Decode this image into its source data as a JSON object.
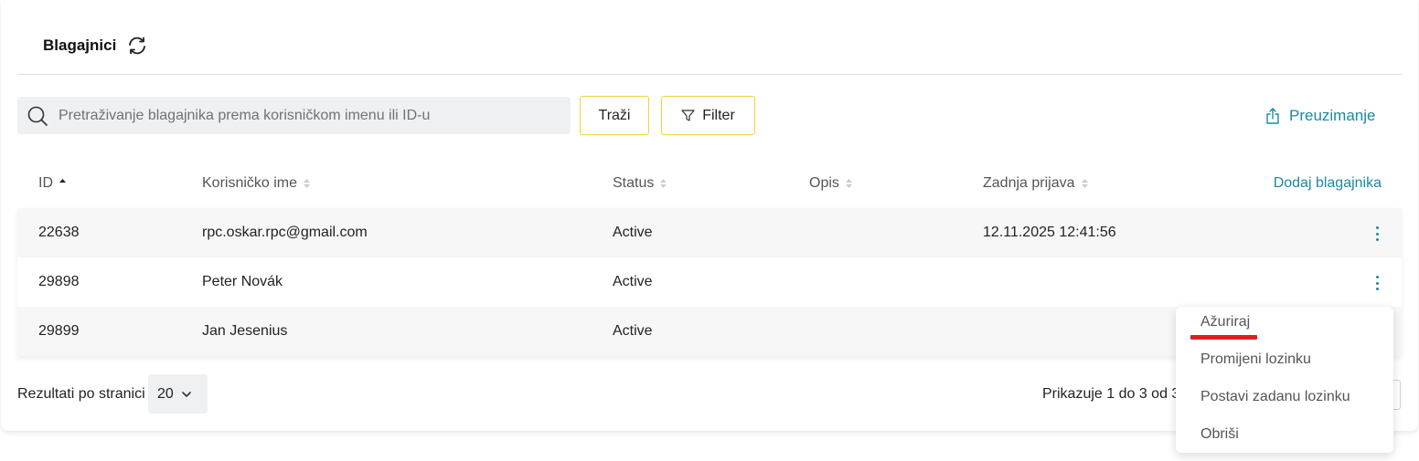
{
  "header": {
    "title": "Blagajnici"
  },
  "search": {
    "placeholder": "Pretraživanje blagajnika prema korisničkom imenu ili ID-u"
  },
  "toolbar": {
    "search_label": "Traži",
    "filter_label": "Filter",
    "download_label": "Preuzimanje"
  },
  "table": {
    "columns": [
      "ID",
      "Korisničko ime",
      "Status",
      "Opis",
      "Zadnja prijava"
    ],
    "add_label": "Dodaj blagajnika",
    "rows": [
      {
        "id": "22638",
        "username": "rpc.oskar.rpc@gmail.com",
        "status": "Active",
        "description": "",
        "last_login": "12.11.2025 12:41:56"
      },
      {
        "id": "29898",
        "username": "Peter Novák",
        "status": "Active",
        "description": "",
        "last_login": ""
      },
      {
        "id": "29899",
        "username": "Jan Jesenius",
        "status": "Active",
        "description": "",
        "last_login": ""
      }
    ]
  },
  "footer": {
    "per_page_label": "Rezultati po stranici",
    "per_page_value": "20",
    "showing": "Prikazuje 1 do 3 od 3"
  },
  "context_menu": {
    "items": [
      "Ažuriraj",
      "Promijeni lozinku",
      "Postavi zadanu lozinku",
      "Obriši"
    ]
  },
  "colors": {
    "accent": "#1a8aa0",
    "button_border": "#f0d23c",
    "highlight": "#e11d1d"
  }
}
